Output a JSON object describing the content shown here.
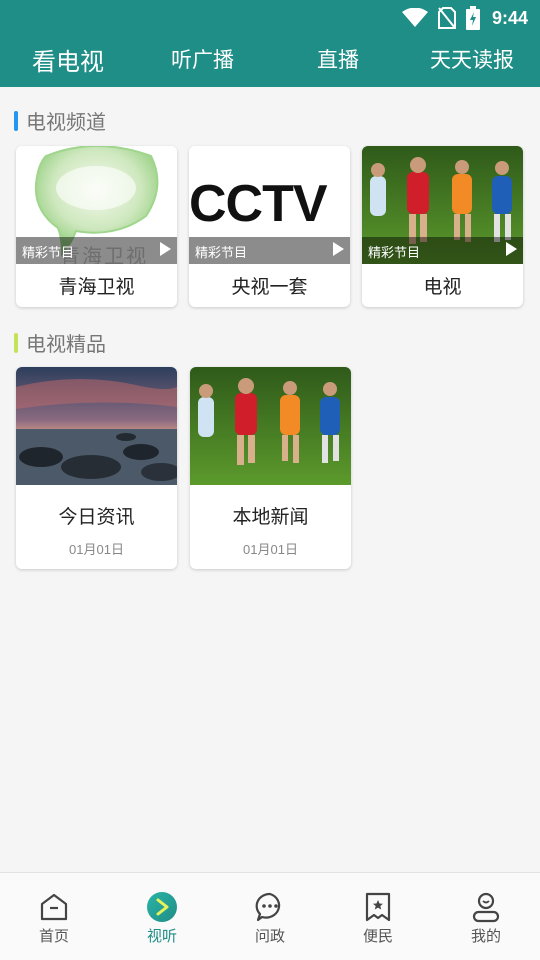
{
  "status_bar": {
    "time": "9:44",
    "icons": [
      "wifi-icon",
      "no-sim-icon",
      "battery-icon"
    ]
  },
  "header": {
    "tabs": [
      {
        "label": "看电视",
        "active": true
      },
      {
        "label": "听广播",
        "active": false
      },
      {
        "label": "直播",
        "active": false
      },
      {
        "label": "天天读报",
        "active": false
      }
    ]
  },
  "sections": [
    {
      "title": "电视频道",
      "accent": "#2196f3",
      "cards": [
        {
          "title": "青海卫视",
          "badge": "精彩节目",
          "thumb_icon": "qinghai-tv-logo",
          "logo_text": "青海卫视"
        },
        {
          "title": "央视一套",
          "badge": "精彩节目",
          "thumb_icon": "cctv-logo",
          "logo_text": "CCTV"
        },
        {
          "title": "电视",
          "badge": "精彩节目",
          "thumb_icon": "soccer-players-image"
        }
      ]
    },
    {
      "title": "电视精品",
      "accent": "#c5e15a",
      "cards": [
        {
          "title": "今日资讯",
          "date": "01月01日",
          "thumb_icon": "sunset-rocks-image"
        },
        {
          "title": "本地新闻",
          "date": "01月01日",
          "thumb_icon": "soccer-players-image"
        }
      ]
    }
  ],
  "bottom_nav": {
    "items": [
      {
        "label": "首页",
        "icon": "home-icon",
        "active": false
      },
      {
        "label": "视听",
        "icon": "play-circle-icon",
        "active": true
      },
      {
        "label": "问政",
        "icon": "chat-bubble-icon",
        "active": false
      },
      {
        "label": "便民",
        "icon": "bookmark-star-icon",
        "active": false
      },
      {
        "label": "我的",
        "icon": "user-icon",
        "active": false
      }
    ]
  },
  "colors": {
    "primary": "#1f8e86",
    "background": "#f5f5f5"
  }
}
